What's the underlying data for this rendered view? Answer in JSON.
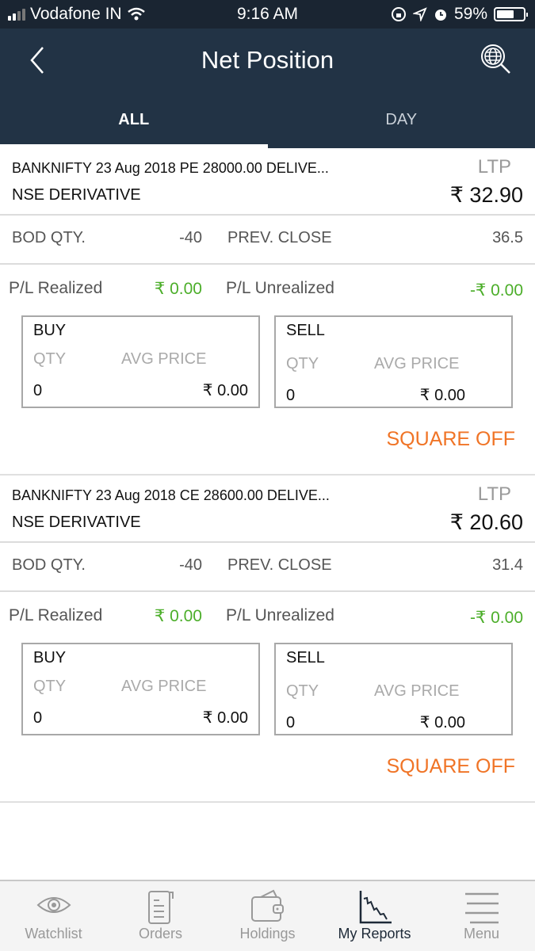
{
  "status_bar": {
    "carrier": "Vodafone IN",
    "time": "9:16 AM",
    "battery": "59%",
    "battery_level": 0.59
  },
  "header": {
    "title": "Net Position",
    "back_icon": "chevron-left-icon",
    "search_icon": "globe-search-icon",
    "tabs": [
      {
        "label": "ALL",
        "active": true
      },
      {
        "label": "DAY",
        "active": false
      }
    ]
  },
  "positions": [
    {
      "symbol": "BANKNIFTY 23 Aug 2018 PE 28000.00 DELIVE...",
      "exchange": "NSE DERIVATIVE",
      "ltp_label": "LTP",
      "ltp": "₹ 32.90",
      "bod_qty_label": "BOD QTY.",
      "bod_qty": "-40",
      "prev_close_label": "PREV. CLOSE",
      "prev_close": "36.5",
      "pl_realized_label": "P/L Realized",
      "pl_realized": "₹ 0.00",
      "pl_unrealized_label": "P/L Unrealized",
      "pl_unrealized": "-₹ 0.00",
      "buy": {
        "title": "BUY",
        "qty_label": "QTY",
        "avg_label": "AVG PRICE",
        "qty": "0",
        "avg": "₹ 0.00"
      },
      "sell": {
        "title": "SELL",
        "qty_label": "QTY",
        "avg_label": "AVG PRICE",
        "qty": "0",
        "avg": "₹ 0.00"
      },
      "action": "SQUARE OFF"
    },
    {
      "symbol": "BANKNIFTY 23 Aug 2018 CE 28600.00 DELIVE...",
      "exchange": "NSE DERIVATIVE",
      "ltp_label": "LTP",
      "ltp": "₹ 20.60",
      "bod_qty_label": "BOD QTY.",
      "bod_qty": "-40",
      "prev_close_label": "PREV. CLOSE",
      "prev_close": "31.4",
      "pl_realized_label": "P/L Realized",
      "pl_realized": "₹ 0.00",
      "pl_unrealized_label": "P/L Unrealized",
      "pl_unrealized": "-₹ 0.00",
      "buy": {
        "title": "BUY",
        "qty_label": "QTY",
        "avg_label": "AVG PRICE",
        "qty": "0",
        "avg": "₹ 0.00"
      },
      "sell": {
        "title": "SELL",
        "qty_label": "QTY",
        "avg_label": "AVG PRICE",
        "qty": "0",
        "avg": "₹ 0.00"
      },
      "action": "SQUARE OFF"
    }
  ],
  "tab_bar": [
    {
      "label": "Watchlist",
      "icon": "eye-icon",
      "active": false
    },
    {
      "label": "Orders",
      "icon": "order-book-icon",
      "active": false
    },
    {
      "label": "Holdings",
      "icon": "wallet-icon",
      "active": false
    },
    {
      "label": "My Reports",
      "icon": "chart-icon",
      "active": true
    },
    {
      "label": "Menu",
      "icon": "hamburger-icon",
      "active": false
    }
  ],
  "colors": {
    "header_bg": "#223345",
    "status_bg": "#1a2532",
    "profit_green": "#4cae2a",
    "action_orange": "#f07426"
  }
}
